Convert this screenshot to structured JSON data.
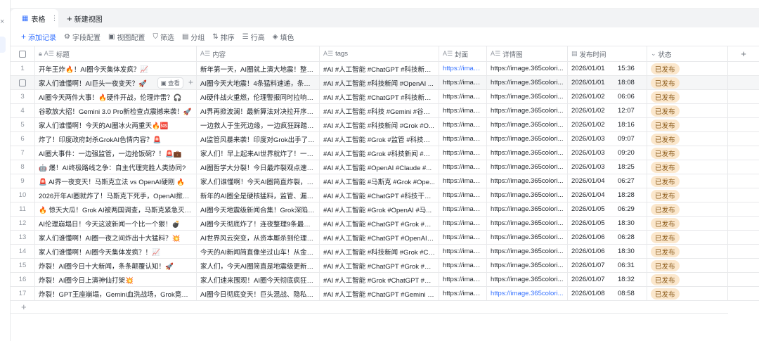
{
  "sidebar": {
    "close_icon": "×"
  },
  "tabs": {
    "active": "表格",
    "more": "⋮",
    "new_view": "新建视图"
  },
  "toolbar": {
    "add_record": "添加记录",
    "fields": "字段配置",
    "view_config": "视图配置",
    "filter": "筛选",
    "group": "分组",
    "sort": "排序",
    "row_height": "行高",
    "fill": "填色"
  },
  "columns": {
    "title": "标题",
    "content": "内容",
    "tags": "tags",
    "cover": "封面",
    "detail": "详情图",
    "time": "发布时间",
    "status": "状态"
  },
  "row_view_button": "查看",
  "colors": {
    "accent": "#3370ff",
    "status_bg": "#fbe7cc"
  },
  "rows": [
    {
      "n": "1",
      "title": "开年王炸🔥！AI圈今天集体发疯？📈",
      "content": "新年第一天，AI圈就上演大地震！整理...",
      "tags": "#AI #人工智能 #ChatGPT #科技新闻 ...",
      "cover": "https://imag...",
      "detail": "https://image.365colori...",
      "date": "2026/01/01",
      "time": "15:36",
      "status": "已发布"
    },
    {
      "n": "2",
      "title": "家人们谁懂啊！AI巨头一夜变天？🚀",
      "content": "AI圈今天大地震！4条猛料速递，条条颠...",
      "tags": "#AI #人工智能 #科技新闻 #OpenAI ...",
      "cover": "https://imag...",
      "detail": "https://image.365colori...",
      "date": "2026/01/01",
      "time": "18:08",
      "status": "已发布"
    },
    {
      "n": "3",
      "title": "AI圈今天两件大事！🔥硬件开战，伦理炸雷？🎧",
      "content": "AI硬件战火重燃，伦理警报同时拉响！...",
      "tags": "#AI #人工智能 #ChatGPT #科技新闻 ...",
      "cover": "https://imag...",
      "detail": "https://image.365colori...",
      "date": "2026/01/02",
      "time": "06:06",
      "status": "已发布"
    },
    {
      "n": "4",
      "title": "谷歌放大招！Gemini 3.0 Pro新检查点震撼来袭！🚀",
      "content": "AI界再掀波澜！最新算法对决拉开序幕...",
      "tags": "#AI #人工智能 #科技 #Gemini #谷歌...",
      "cover": "https://imag...",
      "detail": "https://image.365colori...",
      "date": "2026/01/02",
      "time": "12:07",
      "status": "已发布"
    },
    {
      "n": "5",
      "title": "家人们谁懂啊！今天的AI圈冰火两重天🔥🆘",
      "content": "一边救人于生死边缘，一边疯狂踩踏伦...",
      "tags": "#AI #人工智能 #科技新闻 #Grok #O...",
      "cover": "https://imag...",
      "detail": "https://image.365colori...",
      "date": "2026/01/02",
      "time": "18:16",
      "status": "已发布"
    },
    {
      "n": "6",
      "title": "炸了！印度政府封杀GrokAI色情内容？🚨",
      "content": "AI监管风暴来袭！印度对Grok出手了！ ...",
      "tags": "#AI #人工智能 #Grok #监管 #科技新...",
      "cover": "https://imag...",
      "detail": "https://image.365colori...",
      "date": "2026/01/03",
      "time": "09:07",
      "status": "已发布"
    },
    {
      "n": "7",
      "title": "AI圈大事件：一边强监管，一边抢饭碗？！🚨💼",
      "content": "家人们！早上起来AI世界就炸了！一边...",
      "tags": "#AI #人工智能 #Grok #科技新闻 #监...",
      "cover": "https://imag...",
      "detail": "https://image.365colori...",
      "date": "2026/01/03",
      "time": "09:20",
      "status": "已发布"
    },
    {
      "n": "8",
      "title": "🤖 爆！AI终极路线之争：自主代理完胜人类协同?",
      "content": "AI圈哲学大分裂！今日最炸裂观点速览...",
      "tags": "#AI #人工智能 #OpenAI #Claude #...",
      "cover": "https://imag...",
      "detail": "https://image.365colori...",
      "date": "2026/01/03",
      "time": "18:25",
      "status": "已发布"
    },
    {
      "n": "9",
      "title": "🚨 AI界一夜变天！马斯克立法 vs OpenAI硬刚 🔥",
      "content": "家人们谁懂啊！今天AI圈简直炸裂，巨...",
      "tags": "#AI #人工智能 #马斯克 #Grok #Ope...",
      "cover": "https://imag...",
      "detail": "https://image.365colori...",
      "date": "2026/01/04",
      "time": "06:27",
      "status": "已发布"
    },
    {
      "n": "10",
      "title": "2026开年AI圈就炸了！马斯克下死手，OpenAI掀桌子...",
      "content": "新年的AI圈全是硬核猛料，监管、漏洞...",
      "tags": "#AI #人工智能 #ChatGPT #科技干货 ...",
      "cover": "https://imag...",
      "detail": "https://image.365colori...",
      "date": "2026/01/04",
      "time": "18:28",
      "status": "已发布"
    },
    {
      "n": "11",
      "title": "🔥 惊天大瓜！Grok AI被两国调查，马斯克紧急灭火！",
      "content": "AI圈今天地震级新闻合集！Grok深陷伦...",
      "tags": "#AI #人工智能 #Grok #OpenAI #马...",
      "cover": "https://imag...",
      "detail": "https://image.365colori...",
      "date": "2026/01/05",
      "time": "06:29",
      "status": "已发布"
    },
    {
      "n": "12",
      "title": "AI伦理崩塌日！今天这波新闻一个比一个狠！💣",
      "content": "AI圈今天彻底炸了！连夜整理9条最猛快...",
      "tags": "#AI #人工智能 #ChatGPT #Grok #Op...",
      "cover": "https://imag...",
      "detail": "https://image.365colori...",
      "date": "2026/01/05",
      "time": "18:30",
      "status": "已发布"
    },
    {
      "n": "13",
      "title": "家人们谁懂啊！AI圈一夜之间炸出十大猛料？💥",
      "content": "AI世界风云突变，从资本厮杀到伦理危...",
      "tags": "#AI #人工智能 #ChatGPT #OpenAI #...",
      "cover": "https://imag...",
      "detail": "https://image.365colori...",
      "date": "2026/01/06",
      "time": "06:28",
      "status": "已发布"
    },
    {
      "n": "14",
      "title": "家人们谁懂啊！AI圈今天集体发疯？！📈",
      "content": "今天的AI新闻简直像坐过山车！从金融...",
      "tags": "#AI #人工智能 #科技新闻 #Grok #Ch...",
      "cover": "https://imag...",
      "detail": "https://image.365colori...",
      "date": "2026/01/06",
      "time": "18:30",
      "status": "已发布"
    },
    {
      "n": "15",
      "title": "炸裂！AI圈今日十大新闻，条条颠覆认知！🚀",
      "content": "家人们，今天AI圈简直是地震级更新！...",
      "tags": "#AI #人工智能 #ChatGPT #Grok #科...",
      "cover": "https://imag...",
      "detail": "https://image.365colori...",
      "date": "2026/01/07",
      "time": "06:31",
      "status": "已发布"
    },
    {
      "n": "16",
      "title": "炸裂！AI圈今日上演神仙打架💥",
      "content": "家人们速来围观！AI圈今天彻底疯狂，...",
      "tags": "#AI #人工智能 #Grok #ChatGPT #Op...",
      "cover": "https://imag...",
      "detail": "https://image.365colori...",
      "date": "2026/01/07",
      "time": "18:32",
      "status": "已发布"
    },
    {
      "n": "17",
      "title": "炸裂！GPT王座崩塌，Gemini血洗战场，Grok竟成暗...",
      "content": "AI圈今日彻底变天！巨头混战、隐私危...",
      "tags": "#AI #人工智能 #ChatGPT #Gemini #...",
      "cover": "https://imag...",
      "detail": "https://image.365colori...",
      "date": "2026/01/08",
      "time": "08:58",
      "status": "已发布"
    }
  ]
}
